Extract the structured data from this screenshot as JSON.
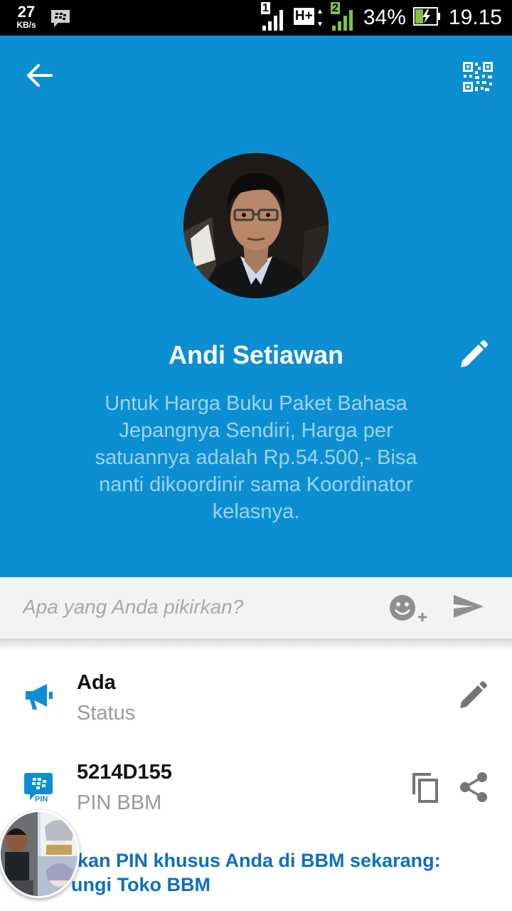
{
  "status_bar": {
    "speed_value": "27",
    "speed_unit": "KB/s",
    "battery": "34%",
    "time": "19.15",
    "sim1_label": "1",
    "sim2_label": "2",
    "network_type": "H+"
  },
  "header": {
    "back_icon": "arrow-left-icon",
    "qr_icon": "qr-code-icon",
    "background_color": "#0b8fd2"
  },
  "profile": {
    "name": "Andi Setiawan",
    "bio": "Untuk Harga Buku Paket Bahasa Jepangnya Sendiri, Harga per satuannya adalah Rp.54.500,- Bisa nanti dikoordinir sama Koordinator kelasnya."
  },
  "compose": {
    "placeholder": "Apa yang Anda pikirkan?",
    "emoji_icon": "emoji-add-icon",
    "send_icon": "send-icon"
  },
  "status_row": {
    "title": "Ada",
    "subtitle": "Status",
    "icon": "megaphone-icon"
  },
  "pin_row": {
    "title": "5214D155",
    "subtitle": "PIN BBM",
    "icon_label": "PIN",
    "copy_icon": "copy-icon",
    "share_icon": "share-icon"
  },
  "promo": {
    "line1": "tkan PIN khusus Anda di BBM sekarang:",
    "line2": "ungi Toko BBM"
  },
  "colors": {
    "accent": "#0b8fd2",
    "link": "#0e6fbd"
  }
}
